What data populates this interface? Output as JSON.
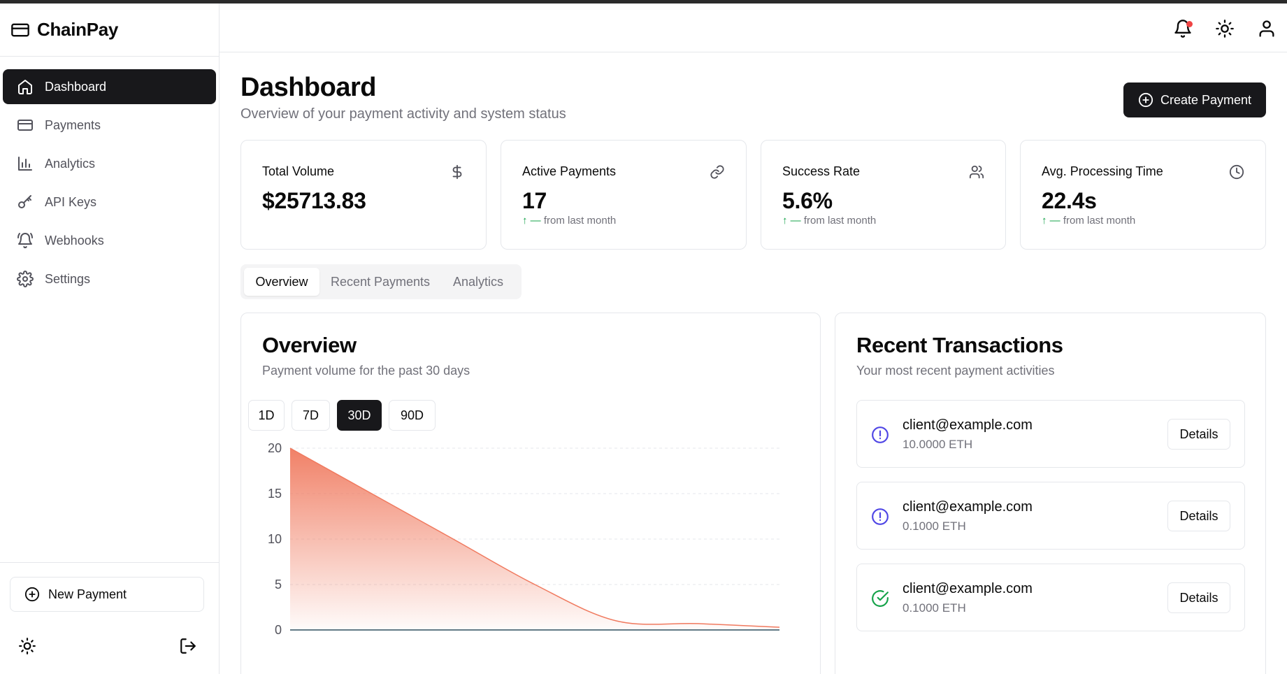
{
  "brand": {
    "name": "ChainPay"
  },
  "sidebar": {
    "items": [
      {
        "label": "Dashboard",
        "icon": "home-icon"
      },
      {
        "label": "Payments",
        "icon": "credit-card-icon"
      },
      {
        "label": "Analytics",
        "icon": "bar-chart-icon"
      },
      {
        "label": "API Keys",
        "icon": "key-icon"
      },
      {
        "label": "Webhooks",
        "icon": "bell-ring-icon"
      },
      {
        "label": "Settings",
        "icon": "gear-icon"
      }
    ],
    "active_index": 0,
    "new_payment_label": "New Payment"
  },
  "header": {
    "notification_dot_color": "#ef4444"
  },
  "page": {
    "title": "Dashboard",
    "subtitle": "Overview of your payment activity and system status",
    "create_button": "Create Payment"
  },
  "stats": [
    {
      "label": "Total Volume",
      "value": "$25713.83",
      "icon": "dollar-icon",
      "delta": ""
    },
    {
      "label": "Active Payments",
      "value": "17",
      "icon": "link-icon",
      "delta_arrow": "↑",
      "delta_change": "—",
      "delta_text": "from last month"
    },
    {
      "label": "Success Rate",
      "value": "5.6%",
      "icon": "users-icon",
      "delta_arrow": "↑",
      "delta_change": "—",
      "delta_text": "from last month"
    },
    {
      "label": "Avg. Processing Time",
      "value": "22.4s",
      "icon": "clock-icon",
      "delta_arrow": "↑",
      "delta_change": "—",
      "delta_text": "from last month"
    }
  ],
  "tabs": [
    {
      "label": "Overview"
    },
    {
      "label": "Recent Payments"
    },
    {
      "label": "Analytics"
    }
  ],
  "overview": {
    "title": "Overview",
    "subtitle": "Payment volume for the past 30 days",
    "ranges": [
      "1D",
      "7D",
      "30D",
      "90D"
    ],
    "active_range": "30D"
  },
  "chart_data": {
    "type": "area",
    "x": [
      1,
      2,
      3,
      4,
      5,
      6,
      7
    ],
    "values": [
      20,
      15,
      10,
      5,
      1,
      0.7,
      0.3
    ],
    "ylim": [
      0,
      20
    ],
    "yticks": [
      "0",
      "5",
      "10",
      "15",
      "20"
    ],
    "color": "#f07a5f",
    "grid": true
  },
  "recent": {
    "title": "Recent Transactions",
    "subtitle": "Your most recent payment activities",
    "transactions": [
      {
        "email": "client@example.com",
        "amount": "10.0000 ETH",
        "status": "pending",
        "icon": "alert-circle-icon",
        "button": "Details"
      },
      {
        "email": "client@example.com",
        "amount": "0.1000 ETH",
        "status": "pending",
        "icon": "alert-circle-icon",
        "button": "Details"
      },
      {
        "email": "client@example.com",
        "amount": "0.1000 ETH",
        "status": "completed",
        "icon": "check-circle-icon",
        "button": "Details"
      }
    ]
  },
  "colors": {
    "accent": "#18181b",
    "pending": "#4f46e5",
    "success": "#16a34a",
    "chart": "#f07a5f"
  }
}
